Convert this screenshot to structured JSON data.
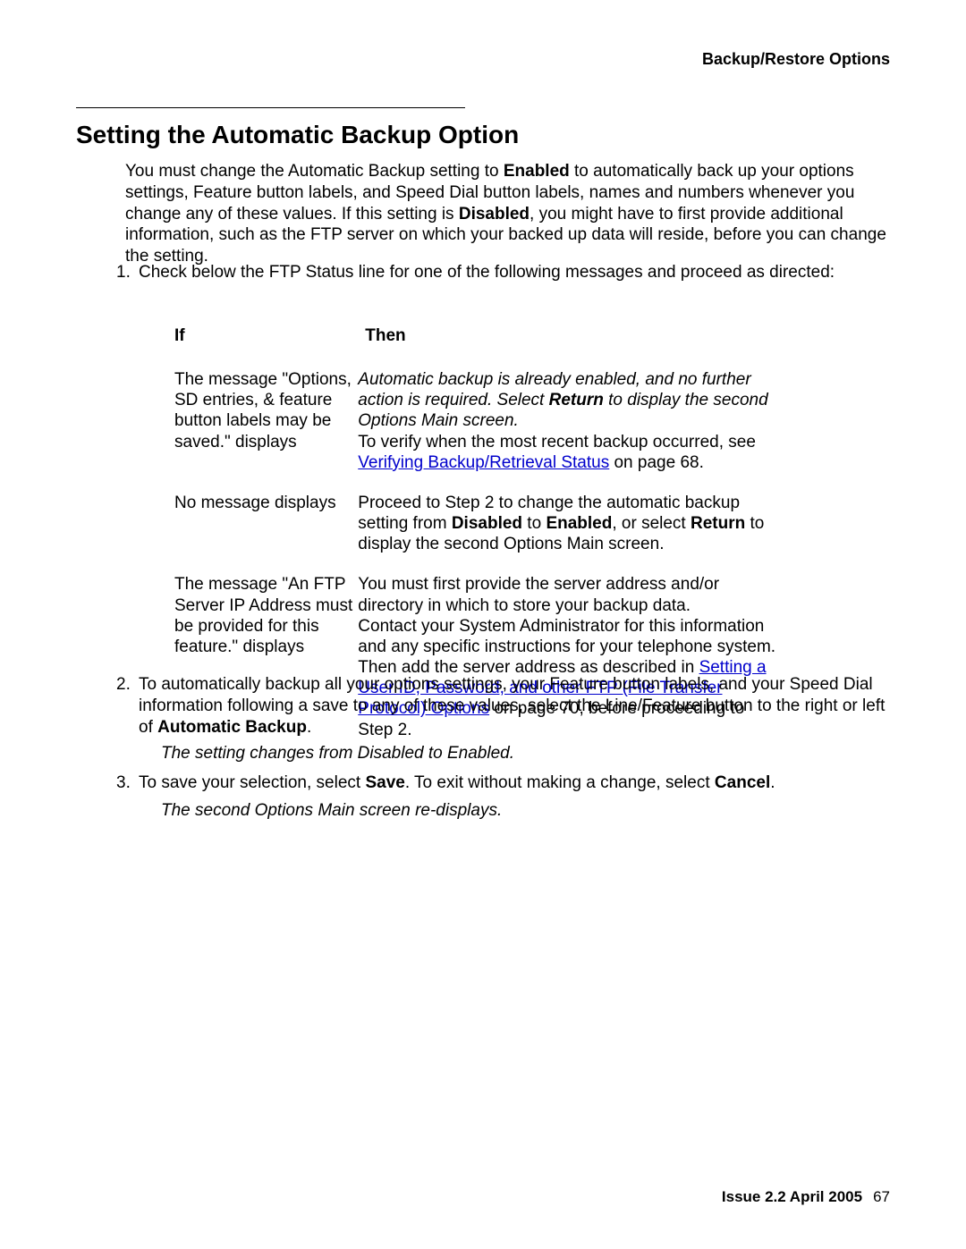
{
  "header": {
    "section": "Backup/Restore Options"
  },
  "heading": "Setting the Automatic Backup Option",
  "intro": {
    "t1": "You must change the Automatic Backup setting to ",
    "b1": "Enabled",
    "t2": " to automatically back up your options settings, Feature button labels, and Speed Dial button labels, names and numbers whenever you change any of these values. If this setting is ",
    "b2": "Disabled",
    "t3": ", you might have to first provide additional information, such as the FTP server on which your backed up data will reside, before you can change the setting."
  },
  "step1": {
    "num": "1.",
    "text": "Check below the FTP Status line for one of the following messages and proceed as directed:"
  },
  "table": {
    "header_if": "If",
    "header_then": "Then",
    "row1": {
      "if_text": "The message \"Options, SD entries, & feature button labels may be saved.\" displays",
      "then_i1": "Automatic backup is already enabled, and no further action is required. Select ",
      "then_ib": "Return",
      "then_i2": " to display the second Options Main screen.",
      "then_t1": "To verify when the most recent backup occurred, see ",
      "then_link": "Verifying Backup/Retrieval Status",
      "then_t2": " on page 68."
    },
    "row2": {
      "if_text": "No message displays",
      "then_t1": "Proceed to Step 2 to change the automatic backup setting from ",
      "then_b1": "Disabled",
      "then_t2": " to ",
      "then_b2": "Enabled",
      "then_t3": ", or select ",
      "then_b3": "Return",
      "then_t4": " to display the second Options Main screen."
    },
    "row3": {
      "if_text": "The message \"An FTP Server IP Address must be provided for this feature.\" displays",
      "then_p1": "You must first provide the server address and/or directory in which to store your backup data.",
      "then_p2a": "Contact your System Administrator for this information and any specific instructions for your telephone system. Then add the server address as described in ",
      "then_link": "Setting a User ID, Password, and other FTP (File Transfer Protocol) Options",
      "then_p2b": " on page 70, before proceeding to Step 2."
    }
  },
  "step2": {
    "num": "2.",
    "t1": "To automatically backup all your options settings, your Feature button labels, and your Speed Dial information following a save to any of these values, select the Line/Feature button to the right or left of ",
    "b1": "Automatic Backup",
    "t2": "."
  },
  "result1": "The setting changes from Disabled to Enabled.",
  "step3": {
    "num": "3.",
    "t1": "To save your selection, select ",
    "b1": "Save",
    "t2": ". To exit without making a change, select ",
    "b2": "Cancel",
    "t3": "."
  },
  "result2": "The second Options Main screen re-displays.",
  "footer": {
    "issue": "Issue 2.2   April 2005",
    "page": "67"
  }
}
